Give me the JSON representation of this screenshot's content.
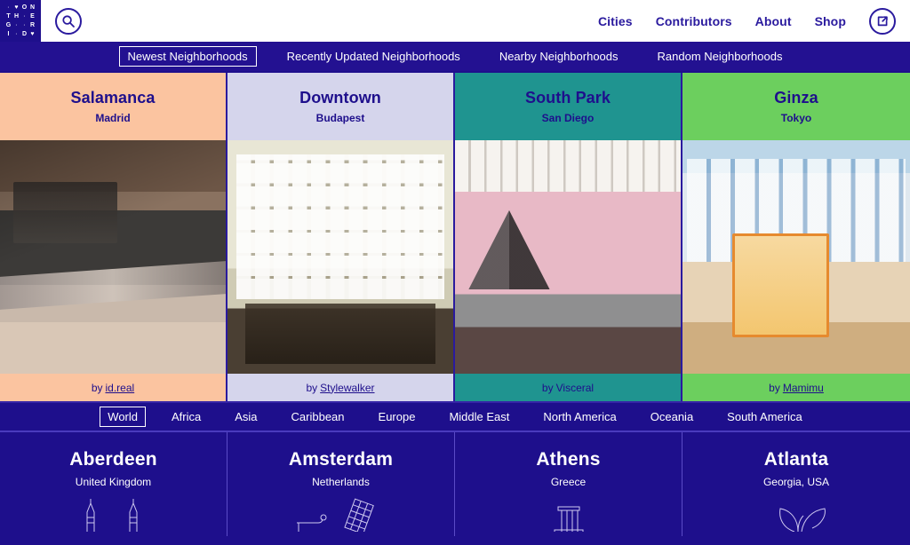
{
  "header": {
    "logo": {
      "name": "on-the-grid-logo",
      "cells": [
        "·",
        "♥",
        "O",
        "N",
        "T",
        "H",
        "·",
        "E",
        "G",
        "·",
        "·",
        "R",
        "I",
        "·",
        "D",
        "♥"
      ]
    },
    "search_icon": "search-icon",
    "share_icon": "share-icon",
    "nav": [
      {
        "label": "Cities",
        "name": "nav-cities"
      },
      {
        "label": "Contributors",
        "name": "nav-contributors"
      },
      {
        "label": "About",
        "name": "nav-about"
      },
      {
        "label": "Shop",
        "name": "nav-shop"
      }
    ]
  },
  "neighborhood_tabs": {
    "active_index": 0,
    "items": [
      {
        "label": "Newest Neighborhoods"
      },
      {
        "label": "Recently Updated Neighborhoods"
      },
      {
        "label": "Nearby Neighborhoods"
      },
      {
        "label": "Random Neighborhoods"
      }
    ]
  },
  "neighborhood_cards": [
    {
      "neighborhood": "Salamanca",
      "city": "Madrid",
      "credit_prefix": "by",
      "credit_name": "id.real",
      "credit_underlined": true,
      "color": "#fbc4a0",
      "photo_class": "ph-cafe",
      "photo_alt": "cafe-interior-photo"
    },
    {
      "neighborhood": "Downtown",
      "city": "Budapest",
      "credit_prefix": "by",
      "credit_name": "Stylewalker",
      "credit_underlined": true,
      "color": "#d5d5ec",
      "photo_class": "ph-gallery",
      "photo_alt": "print-gallery-photo"
    },
    {
      "neighborhood": "South Park",
      "city": "San Diego",
      "credit_prefix": "by",
      "credit_name": "Visceral",
      "credit_underlined": false,
      "color": "#1f9490",
      "photo_class": "ph-bar",
      "photo_alt": "bar-interior-photo"
    },
    {
      "neighborhood": "Ginza",
      "city": "Tokyo",
      "credit_prefix": "by",
      "credit_name": "Mamimu",
      "credit_underlined": true,
      "color": "#6ccf5e",
      "photo_class": "ph-museum",
      "photo_alt": "museum-exhibit-photo"
    }
  ],
  "region_tabs": {
    "active_index": 0,
    "items": [
      {
        "label": "World"
      },
      {
        "label": "Africa"
      },
      {
        "label": "Asia"
      },
      {
        "label": "Caribbean"
      },
      {
        "label": "Europe"
      },
      {
        "label": "Middle East"
      },
      {
        "label": "North America"
      },
      {
        "label": "Oceania"
      },
      {
        "label": "South America"
      }
    ]
  },
  "city_tiles": [
    {
      "city": "Aberdeen",
      "region": "United Kingdom",
      "icon": "twin-spires-icon"
    },
    {
      "city": "Amsterdam",
      "region": "Netherlands",
      "icon": "canal-house-icon"
    },
    {
      "city": "Athens",
      "region": "Greece",
      "icon": "column-icon"
    },
    {
      "city": "Atlanta",
      "region": "Georgia, USA",
      "icon": "peach-leaf-icon"
    }
  ],
  "colors": {
    "brand_navy": "#1e0f8c",
    "brand_navy_alt": "#231191",
    "ink": "#2a1a9e",
    "white": "#ffffff"
  }
}
